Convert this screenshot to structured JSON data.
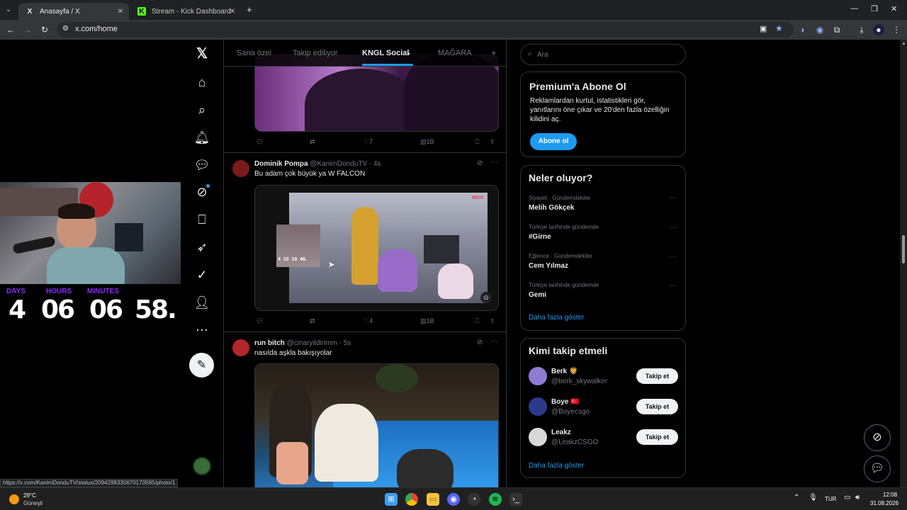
{
  "browser": {
    "tabs": [
      {
        "title": "Anasayfa / X",
        "favicon": "X"
      },
      {
        "title": "Stream - Kick Dashboard",
        "favicon": "K"
      }
    ],
    "url": "x.com/home",
    "status_url": "https://x.com/KanimDonduTV/status/2094288330670170565/photo/1"
  },
  "overlay": {
    "countdown": {
      "labels": [
        "DAYS",
        "HOURS",
        "MINUTES"
      ],
      "days": "4",
      "hours": "06",
      "minutes": "06",
      "seconds": "58.",
      "label_color": "#8f2bff"
    },
    "clip_timer": "4  10  19  46."
  },
  "timeline": {
    "tabs": [
      "Sana özel",
      "Takip ediliyor",
      "KNGL Social",
      "MAĞARA",
      "+"
    ],
    "selected_tab": "KNGL Social",
    "tweets": [
      {
        "likes": "7",
        "views": "1B"
      },
      {
        "name": "Dominik Pompa",
        "handle": "@KanimDonduTV · 4s",
        "text": "Bu adam çok büyük ya W FALCON",
        "likes": "4",
        "views": "1B",
        "media_badge": "MAX"
      },
      {
        "name": "run bitch",
        "handle": "@cinaryildirimm · 5s",
        "text": "nasılda aşkla bakışıyolar"
      }
    ]
  },
  "right": {
    "search_placeholder": "Ara",
    "premium": {
      "title": "Premium'a Abone Ol",
      "body": "Reklamlardan kurtul, istatistikleri gör, yanıtlarını öne çıkar ve 20'den fazla özelliğin kilidini aç.",
      "button": "Abone ol"
    },
    "trends": {
      "title": "Neler oluyor?",
      "items": [
        {
          "category": "Siyaset · Gündemdekiler",
          "name": "Melih Gökçek"
        },
        {
          "category": "Türkiye tarihinde gündemde",
          "name": "#Girne"
        },
        {
          "category": "Eğlence · Gündemdekiler",
          "name": "Cem Yılmaz"
        },
        {
          "category": "Türkiye tarihinde gündemde",
          "name": "Gemi"
        }
      ],
      "more": "Daha fazla göster"
    },
    "who_to_follow": {
      "title": "Kimi takip etmeli",
      "users": [
        {
          "name": "Berk 🦁",
          "handle": "@berk_skywalker",
          "button": "Takip et"
        },
        {
          "name": "Boye 🇹🇷",
          "handle": "@Boyecsgo",
          "button": "Takip et"
        },
        {
          "name": "Leakz",
          "handle": "@LeakzCSGO",
          "button": "Takip et"
        }
      ],
      "more": "Daha fazla göster"
    }
  },
  "taskbar": {
    "weather_temp": "29°C",
    "weather_desc": "Güneşli",
    "language": "TUR",
    "time": "12:08",
    "date": "31.08.2026"
  },
  "colors": {
    "accent": "#1d9bf0",
    "bg": "#000000",
    "border": "#2f3336"
  }
}
